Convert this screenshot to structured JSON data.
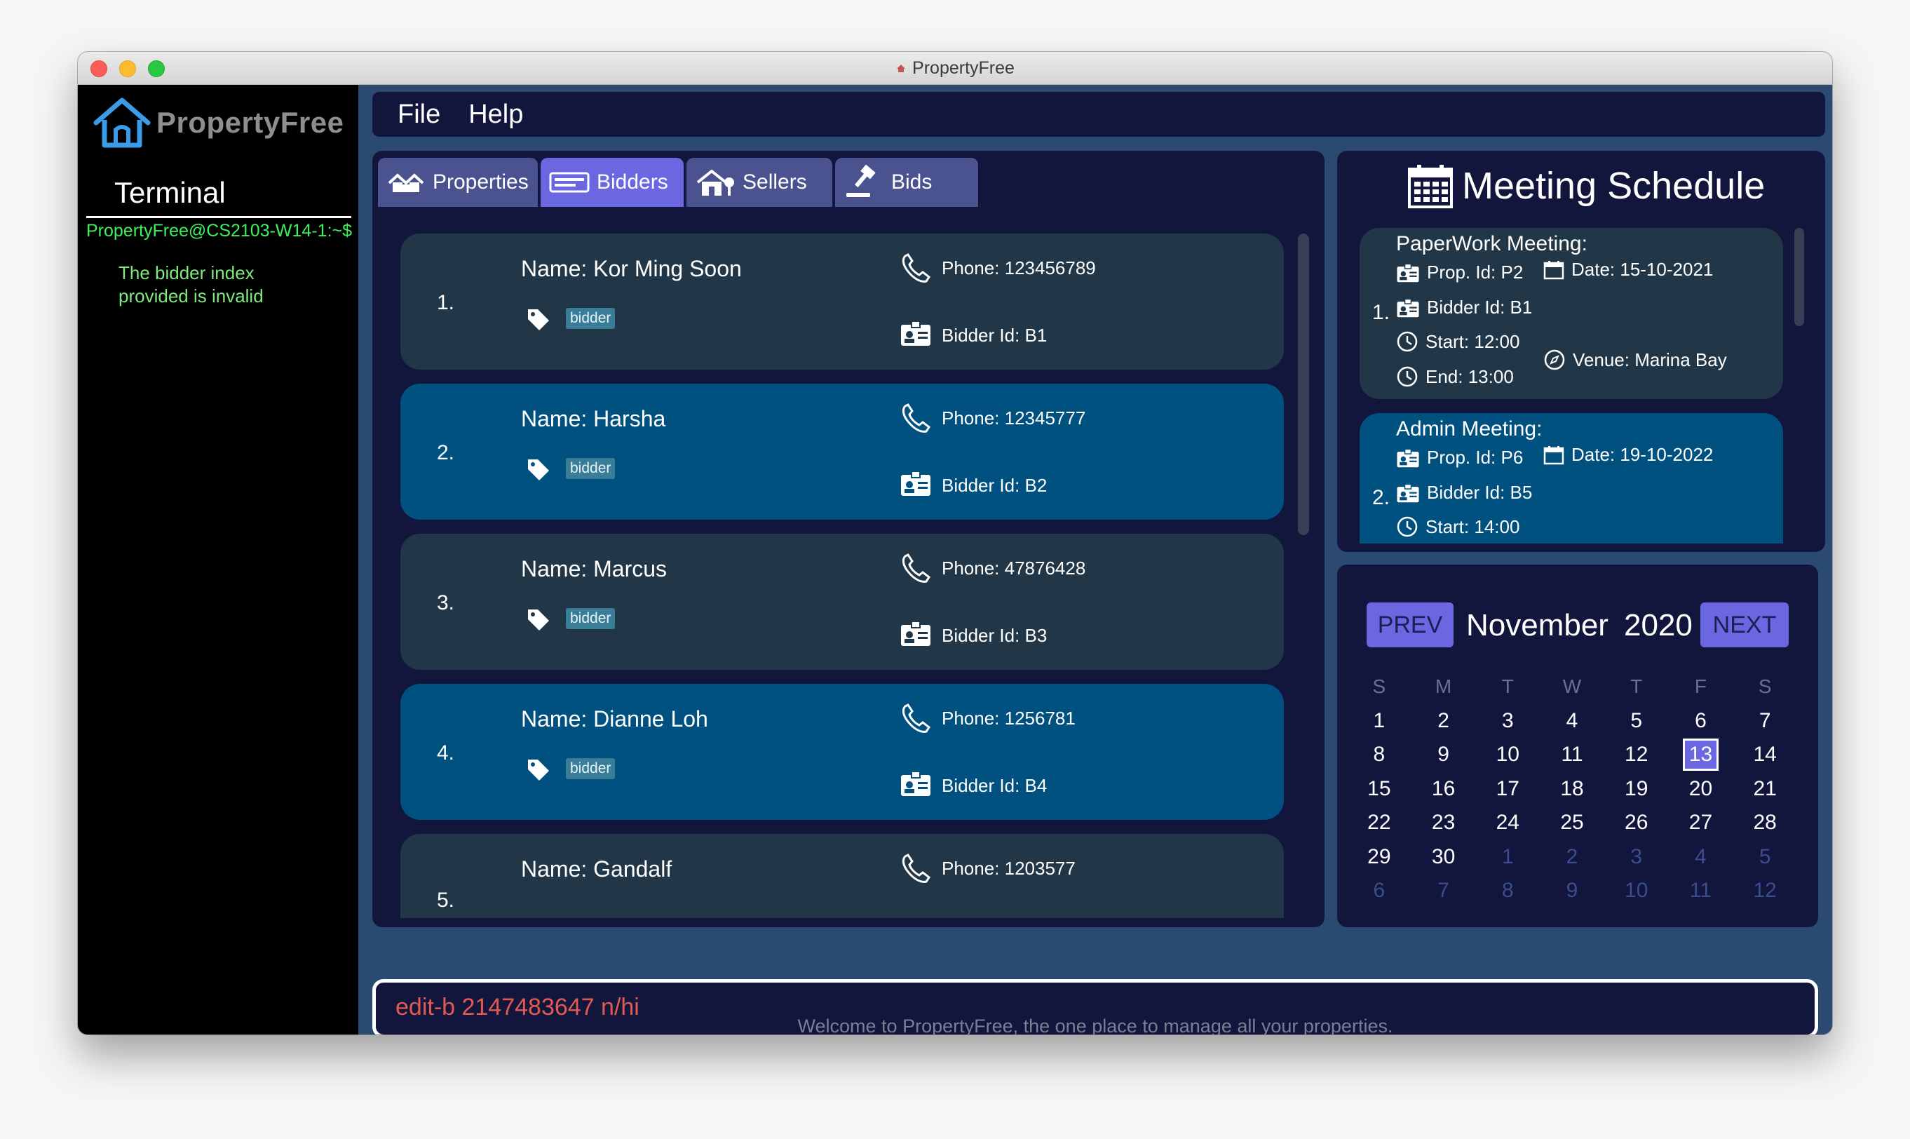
{
  "window": {
    "title": "PropertyFree"
  },
  "terminal": {
    "logo_text": "PropertyFree",
    "title": "Terminal",
    "prompt": "PropertyFree@CS2103-W14-1:~$",
    "message_line1": "The bidder index",
    "message_line2": "provided is invalid"
  },
  "menu": {
    "file": "File",
    "help": "Help"
  },
  "tabs": [
    {
      "label": "Properties",
      "icon": "house-icon"
    },
    {
      "label": "Bidders",
      "icon": "id-card-icon"
    },
    {
      "label": "Sellers",
      "icon": "house-tree-icon"
    },
    {
      "label": "Bids",
      "icon": "gavel-icon"
    }
  ],
  "active_tab": "Bidders",
  "bidders": [
    {
      "index": "1.",
      "name": "Name: Kor Ming Soon",
      "tag": "bidder",
      "phone": "Phone: 123456789",
      "bidder_id": "Bidder Id: B1"
    },
    {
      "index": "2.",
      "name": "Name: Harsha",
      "tag": "bidder",
      "phone": "Phone: 12345777",
      "bidder_id": "Bidder Id: B2"
    },
    {
      "index": "3.",
      "name": "Name: Marcus",
      "tag": "bidder",
      "phone": "Phone: 47876428",
      "bidder_id": "Bidder Id: B3"
    },
    {
      "index": "4.",
      "name": "Name: Dianne Loh",
      "tag": "bidder",
      "phone": "Phone: 1256781",
      "bidder_id": "Bidder Id: B4"
    },
    {
      "index": "5.",
      "name": "Name: Gandalf",
      "tag": "",
      "phone": "Phone: 1203577",
      "bidder_id": ""
    }
  ],
  "meetings": {
    "title": "Meeting Schedule",
    "items": [
      {
        "index": "1.",
        "title": "PaperWork Meeting:",
        "prop_id": "Prop. Id: P2",
        "date": "Date: 15-10-2021",
        "bidder_id": "Bidder Id: B1",
        "start": "Start: 12:00",
        "end": "End: 13:00",
        "venue": "Venue: Marina Bay"
      },
      {
        "index": "2.",
        "title": "Admin Meeting:",
        "prop_id": "Prop. Id: P6",
        "date": "Date: 19-10-2022",
        "bidder_id": "Bidder Id: B5",
        "start": "Start: 14:00",
        "end": "",
        "venue": ""
      }
    ]
  },
  "calendar": {
    "prev": "PREV",
    "next": "NEXT",
    "month": "November",
    "year": "2020",
    "weekdays": [
      "S",
      "M",
      "T",
      "W",
      "T",
      "F",
      "S"
    ],
    "today": "13",
    "weeks": [
      [
        "1",
        "2",
        "3",
        "4",
        "5",
        "6",
        "7"
      ],
      [
        "8",
        "9",
        "10",
        "11",
        "12",
        "13",
        "14"
      ],
      [
        "15",
        "16",
        "17",
        "18",
        "19",
        "20",
        "21"
      ],
      [
        "22",
        "23",
        "24",
        "25",
        "26",
        "27",
        "28"
      ],
      [
        "29",
        "30",
        "1",
        "2",
        "3",
        "4",
        "5"
      ],
      [
        "6",
        "7",
        "8",
        "9",
        "10",
        "11",
        "12"
      ]
    ]
  },
  "command": {
    "value": "edit-b 2147483647 n/hi"
  },
  "status": "Welcome to PropertyFree, the one place to manage all your properties.",
  "colors": {
    "accent": "#6a67e0",
    "panel": "#12163c",
    "card_dark": "#213748",
    "card_blue": "#005080",
    "error": "#e35a50"
  }
}
